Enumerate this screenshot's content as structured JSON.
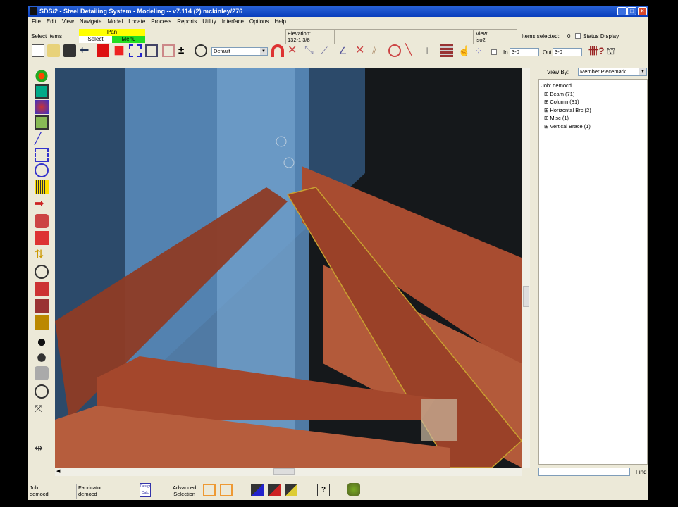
{
  "window": {
    "title": "SDS/2 - Steel Detailing System - Modeling  --  v7.114  (2) mckinley/276"
  },
  "menu": [
    "File",
    "Edit",
    "View",
    "Navigate",
    "Model",
    "Locate",
    "Process",
    "Reports",
    "Utility",
    "Interface",
    "Options",
    "Help"
  ],
  "status": {
    "prompt": "Select Items",
    "pan": "Pan",
    "select": "Select",
    "menu": "Menu",
    "elevation_label": "Elevation:",
    "elevation_value": "132-1 3/8",
    "view_label": "View:",
    "view_value": "iso2",
    "items_selected_label": "Items selected:",
    "items_selected_value": "0",
    "status_display_label": "Status Display",
    "status_display_checked": false
  },
  "toolbar": {
    "layer_select": "Default",
    "in_label": "In",
    "in_value": "3-0",
    "out_label": "Out",
    "out_value": "3-0"
  },
  "right_panel": {
    "view_by_label": "View By:",
    "view_by_value": "Member Piecemark",
    "tree_root": "Job: democd",
    "tree_items": [
      "Beam (71)",
      "Column (31)",
      "Horizontal Brc (2)",
      "Misc (1)",
      "Vertical Brace (1)"
    ],
    "find_label": "Find"
  },
  "bottom": {
    "job_label": "Job:",
    "job_value": "democd",
    "fabricator_label": "Fabricator:",
    "fabricator_value": "democd",
    "adv_sel_line1": "Advanced",
    "adv_sel_line2": "Selection",
    "design_calc": "Design Calc"
  },
  "colors": {
    "title_bar": "#0a3ebc",
    "pan": "#ffff00",
    "menu_green": "#22dd22",
    "steel": "#b5573a",
    "column_blue": "#5d8fbf"
  }
}
